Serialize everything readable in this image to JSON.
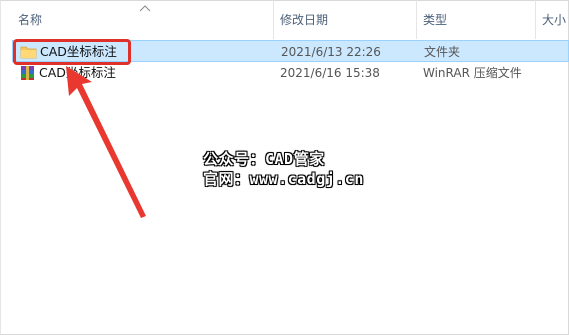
{
  "columns": {
    "name": "名称",
    "modified": "修改日期",
    "type": "类型",
    "size": "大小"
  },
  "rows": [
    {
      "name": "CAD坐标标注",
      "modified": "2021/6/13 22:26",
      "type": "文件夹",
      "icon": "folder-icon",
      "selected": true
    },
    {
      "name": "CAD坐标标注",
      "modified": "2021/6/16 15:38",
      "type": "WinRAR 压缩文件",
      "icon": "winrar-archive-icon",
      "selected": false
    }
  ],
  "watermark": {
    "line1": "公众号：CAD管家",
    "line2": "官网：www.cadgj.cn"
  },
  "colors": {
    "selection_bg": "#cce8ff",
    "selection_border": "#99d1ff",
    "annotation_red": "#e0302a",
    "header_text": "#4c607a"
  }
}
